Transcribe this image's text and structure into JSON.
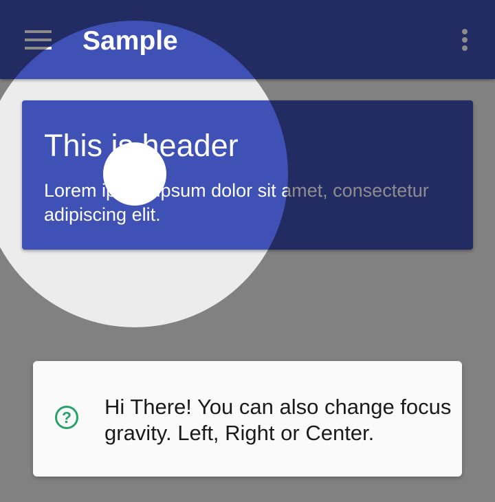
{
  "app_bar": {
    "title": "Sample",
    "menu_icon": "hamburger-menu-icon",
    "overflow_icon": "more-vert-icon",
    "color": "#3f51b5"
  },
  "header_card": {
    "title": "This is header",
    "body": "Lorem ipsum ipsum dolor sit amet, consectetur adipiscing elit.",
    "color": "#3f51b5"
  },
  "showcase": {
    "overlay_color": "rgba(0,0,0,0.45)",
    "hint": {
      "icon": "help-circle-icon",
      "icon_glyph": "?",
      "icon_color": "#26a269",
      "text": "Hi There! You can also change focus gravity. Left, Right or Center."
    }
  }
}
